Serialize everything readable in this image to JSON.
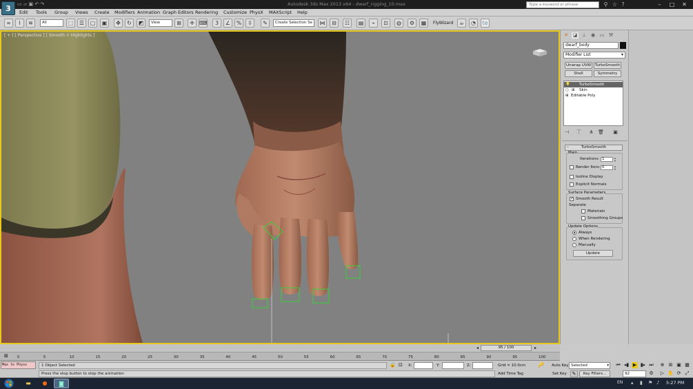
{
  "window": {
    "title": "Autodesk 3ds Max 2013 x64 - dwarf_rigging_10.max",
    "logo": "3"
  },
  "help_search": {
    "placeholder": "Type a keyword or phrase"
  },
  "menu": [
    "Edit",
    "Tools",
    "Group",
    "Views",
    "Create",
    "Modifiers",
    "Animation",
    "Graph Editors",
    "Rendering",
    "Customize",
    "MAXScript",
    "Help"
  ],
  "physx_menu": "PhysX",
  "toolbar": {
    "selection_filter": "All",
    "reference_coord": "View",
    "named_selection": "Create Selection Se",
    "flywizard": "FlyWizard",
    "te_label": "te"
  },
  "viewport": {
    "label": "[ + ] [ Perspective ] [ Smooth + Highlights ]",
    "accent_color": "#e8c81a",
    "background_color": "#818181"
  },
  "command_panel": {
    "object_name": "dwarf_body",
    "object_color": "#111111",
    "modifier_list": "Modifier List",
    "modifier_buttons": [
      "Unwrap UVW",
      "TurboSmooth",
      "Shell",
      "Symmetry"
    ],
    "stack": [
      {
        "label": "TurboSmooth",
        "selected": true
      },
      {
        "label": "Skin",
        "selected": false
      },
      {
        "label": "Editable Poly",
        "selected": false
      }
    ],
    "turbosmooth": {
      "header": "TurboSmooth",
      "main_group": "Main",
      "iterations_label": "Iterations:",
      "iterations_value": "1",
      "render_iters_label": "Render Iters:",
      "render_iters_value": "0",
      "isoline_display": "Isoline Display",
      "explicit_normals": "Explicit Normals",
      "surface_group": "Surface Parameters",
      "smooth_result": "Smooth Result",
      "separate_label": "Separate",
      "materials": "Materials",
      "smoothing_groups": "Smoothing Groups",
      "update_group": "Update Options",
      "always": "Always",
      "when_rendering": "When Rendering",
      "manually": "Manually",
      "update_button": "Update"
    }
  },
  "time_slider": {
    "label": "95 / 100",
    "current": 95,
    "total": 100
  },
  "track_ticks": [
    "0",
    "5",
    "10",
    "15",
    "20",
    "25",
    "30",
    "35",
    "40",
    "45",
    "50",
    "55",
    "60",
    "65",
    "70",
    "75",
    "80",
    "85",
    "90",
    "95",
    "100"
  ],
  "status": {
    "maxscript": "Max to Physx",
    "selection": "1 Object Selected",
    "prompt": "Press the stop button to stop the animation",
    "x_label": "X:",
    "y_label": "Y:",
    "z_label": "Z:",
    "grid": "Grid = 10.0cm",
    "add_time_tag": "Add Time Tag",
    "auto_key": "Auto Key",
    "auto_key_mode": "Selected",
    "set_key": "Set Key",
    "key_filters": "Key Filters...",
    "frame": "92"
  },
  "taskbar": {
    "lang": "EN",
    "clock": "5:27 PM"
  }
}
